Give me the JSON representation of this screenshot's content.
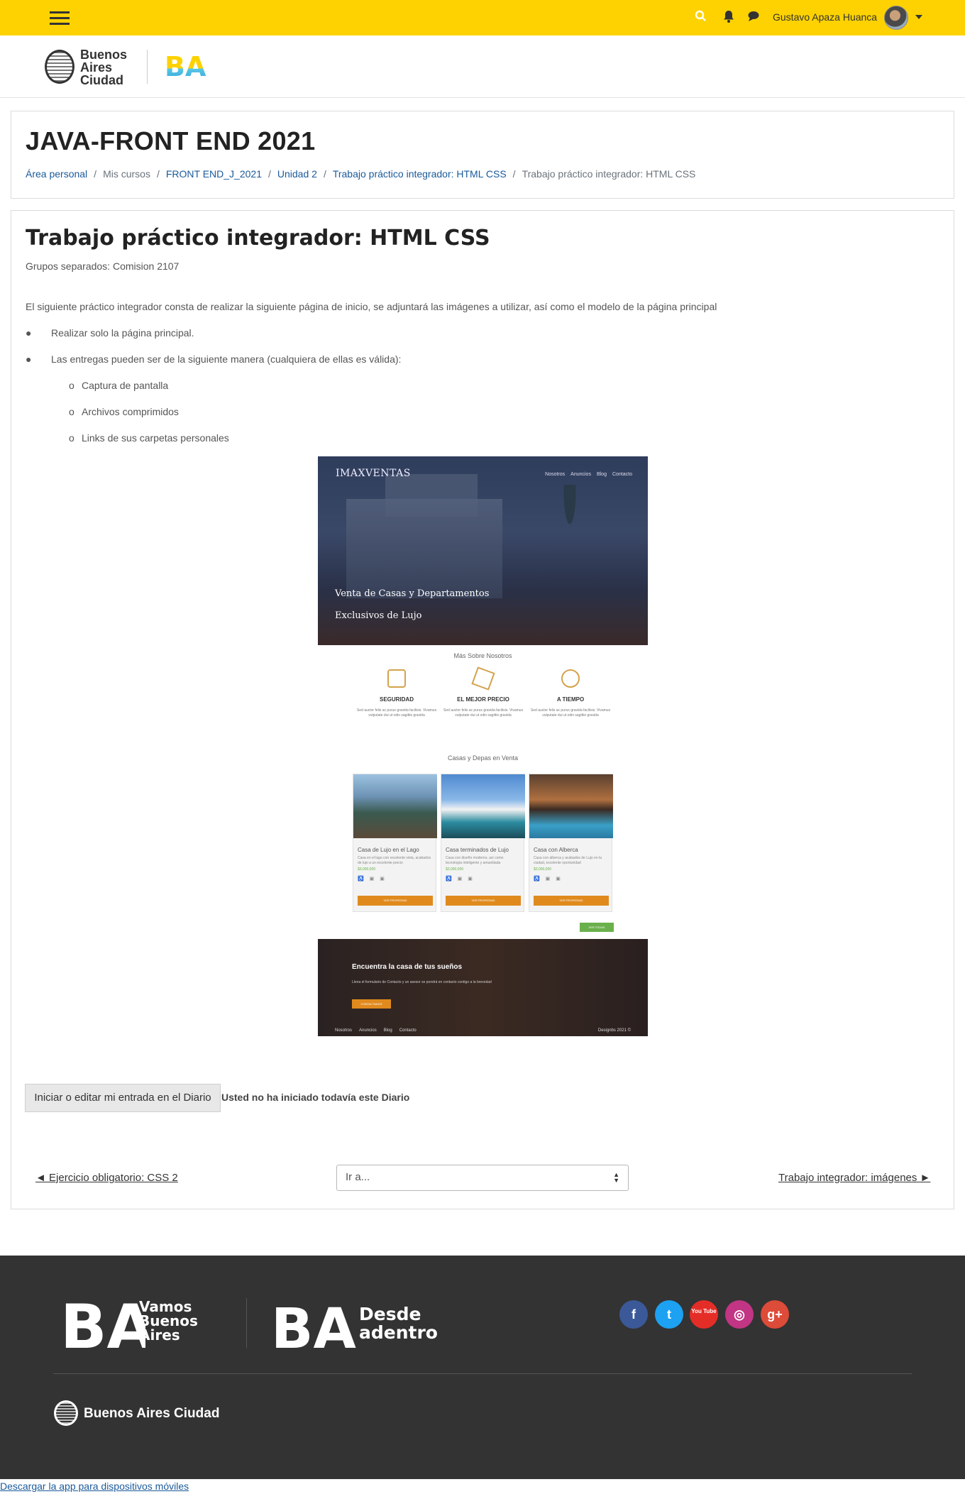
{
  "topbar": {
    "user_name": "Gustavo Apaza Huanca",
    "accent_color": "#fdd200",
    "icons": [
      "hamburger-menu-icon",
      "search-icon",
      "bell-icon",
      "chat-icon",
      "caret-down-icon"
    ]
  },
  "branding": {
    "city_logo_lines": [
      "Buenos",
      "Aires",
      "Ciudad"
    ],
    "ba_logo": "BA"
  },
  "header": {
    "course_title": "JAVA-FRONT END 2021",
    "breadcrumb": [
      {
        "label": "Área personal",
        "link": true
      },
      {
        "label": "Mis cursos",
        "link": false
      },
      {
        "label": "FRONT END_J_2021",
        "link": true
      },
      {
        "label": "Unidad 2",
        "link": true
      },
      {
        "label": "Trabajo práctico integrador: HTML CSS",
        "link": true
      },
      {
        "label": "Trabajo práctico integrador: HTML CSS",
        "link": false
      }
    ]
  },
  "activity": {
    "title": "Trabajo práctico integrador: HTML CSS",
    "groups": "Grupos separados: Comision 2107",
    "intro": "El siguiente práctico integrador consta de realizar la siguiente página de inicio, se adjuntará las imágenes a utilizar, así como el modelo de la página principal",
    "bullets": [
      "Realizar solo la página principal.",
      "Las entregas pueden ser de la siguiente manera (cualquiera de ellas es válida):"
    ],
    "sub_bullets": [
      "Captura de pantalla",
      "Archivos comprimidos",
      "Links de sus carpetas personales"
    ],
    "bullet_marker": "●",
    "sub_marker": "o"
  },
  "mockup": {
    "brand": "IMAXVENTAS",
    "nav": [
      "Nosotros",
      "Anuncios",
      "Blog",
      "Contacto"
    ],
    "hero_title": "Venta de Casas y Departamentos Exclusivos de Lujo",
    "about_heading": "Más Sobre Nosotros",
    "features": [
      {
        "title": "SEGURIDAD",
        "text": "Sed auctor felis ac purus gravida facilisis. Vivamus vulputate dui ut odio sagittis gravida"
      },
      {
        "title": "EL MEJOR PRECIO",
        "text": "Sed auctor felis ac purus gravida facilisis. Vivamus vulputate dui ut odio sagittis gravida"
      },
      {
        "title": "A TIEMPO",
        "text": "Sed auctor felis ac purus gravida facilisis. Vivamus vulputate dui ut odio sagittis gravida"
      }
    ],
    "listing_heading": "Casas y Depas en Venta",
    "listings": [
      {
        "title": "Casa de Lujo en el Lago",
        "text": "Casa en el lago con excelente vista, acabados de lujo a un excelente precio",
        "price": "$3,000,000",
        "button": "VER PROPIEDAD"
      },
      {
        "title": "Casa terminados de Lujo",
        "text": "Casa con diseño moderno, así como tecnología inteligente y amueblada",
        "price": "$3,000,000",
        "button": "VER PROPIEDAD"
      },
      {
        "title": "Casa con Alberca",
        "text": "Casa con alberca y acabados de Lujo en la ciudad, excelente oportunidad",
        "price": "$3,000,000",
        "button": "VER PROPIEDAD"
      }
    ],
    "view_all": "VER TODAS",
    "banner_title": "Encuentra la casa de tus sueños",
    "banner_text": "Llena el formulario de Contacto y un asesor se pondrá en contacto contigo a la brevedad",
    "banner_button": "CONTACTANOS",
    "footer_nav": [
      "Nosotros",
      "Anuncios",
      "Blog",
      "Contacto"
    ],
    "copyright": "Designbs 2021 ©"
  },
  "diary": {
    "button": "Iniciar o editar mi entrada en el Diario",
    "status": "Usted no ha iniciado todavía este Diario"
  },
  "navigation": {
    "prev": "◄ Ejercicio obligatorio: CSS 2",
    "jump_selected": "Ir a...",
    "next": "Trabajo integrador: imágenes ►"
  },
  "footer": {
    "vamos_lines": [
      "Vamos",
      "Buenos",
      "Aires"
    ],
    "desde_lines": [
      "Desde",
      "adentro"
    ],
    "ba_logo": "BA",
    "social": [
      {
        "name": "facebook-icon",
        "glyph": "f",
        "color": "#3b5998"
      },
      {
        "name": "twitter-icon",
        "glyph": "t",
        "color": "#1da1f2"
      },
      {
        "name": "youtube-icon",
        "glyph": "You Tube",
        "color": "#e52d27"
      },
      {
        "name": "instagram-icon",
        "glyph": "◎",
        "color": "#c13584"
      },
      {
        "name": "google-plus-icon",
        "glyph": "g+",
        "color": "#dd4b39"
      }
    ],
    "city_name": "Buenos Aires Ciudad",
    "bg_color": "#333333"
  },
  "app_link": "Descargar la app para dispositivos móviles"
}
